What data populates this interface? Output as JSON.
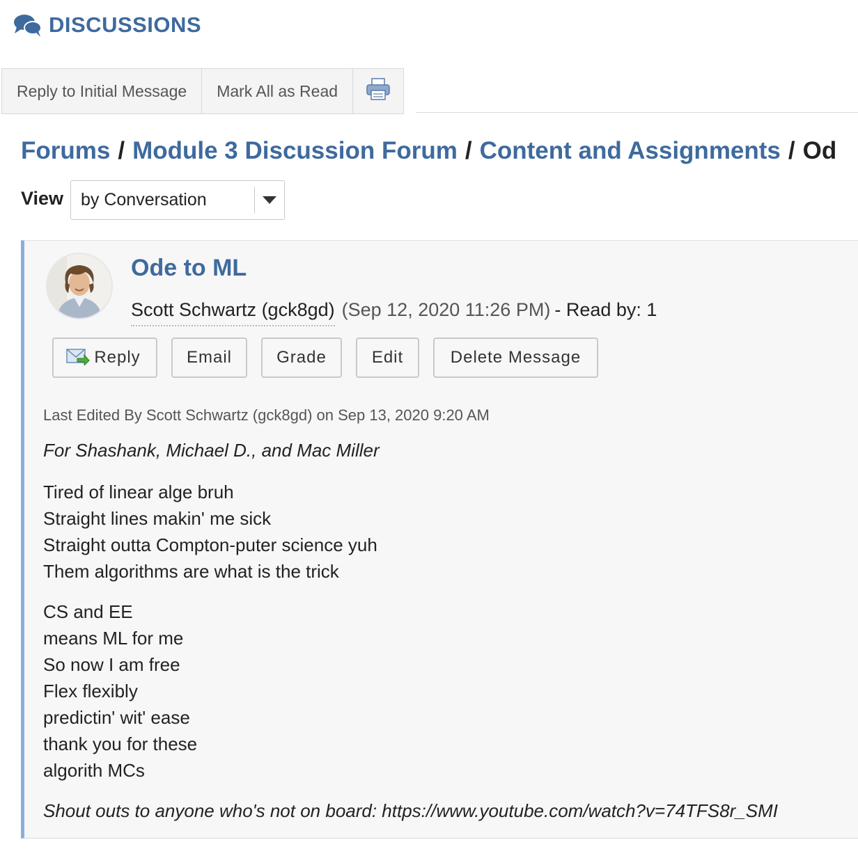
{
  "header": {
    "title": "DISCUSSIONS",
    "icon": "speech-bubbles-icon",
    "accent_color": "#3e6a9e"
  },
  "toolbar": {
    "reply_initial_label": "Reply to Initial Message",
    "mark_read_label": "Mark All as Read",
    "print_icon": "printer-icon"
  },
  "breadcrumb": {
    "items": [
      "Forums",
      "Module 3 Discussion Forum",
      "Content and Assignments"
    ],
    "separator": "/",
    "current": "Od"
  },
  "view": {
    "label": "View",
    "selected": "by Conversation"
  },
  "message": {
    "title": "Ode to ML",
    "author": "Scott Schwartz (gck8gd)",
    "date": "(Sep 12, 2020 11:26 PM)",
    "read_by": "- Read by: 1",
    "actions": {
      "reply": "Reply",
      "email": "Email",
      "grade": "Grade",
      "edit": "Edit",
      "delete": "Delete Message"
    },
    "last_edited": "Last Edited By Scott Schwartz (gck8gd) on Sep 13, 2020 9:20 AM",
    "dedication": "For Shashank, Michael D., and Mac Miller",
    "stanza1": [
      "Tired of linear alge bruh",
      "Straight lines makin' me sick",
      "Straight outta Compton-puter science yuh",
      "Them algorithms are what is the trick"
    ],
    "stanza2": [
      "CS and EE",
      "means ML for me",
      "So now I am free",
      "Flex flexibly",
      "predictin' wit' ease",
      "thank you for these",
      "algorith MCs"
    ],
    "shoutout": "Shout outs to anyone who's not on board: https://www.youtube.com/watch?v=74TFS8r_SMI",
    "border_color": "#8aaee0"
  }
}
